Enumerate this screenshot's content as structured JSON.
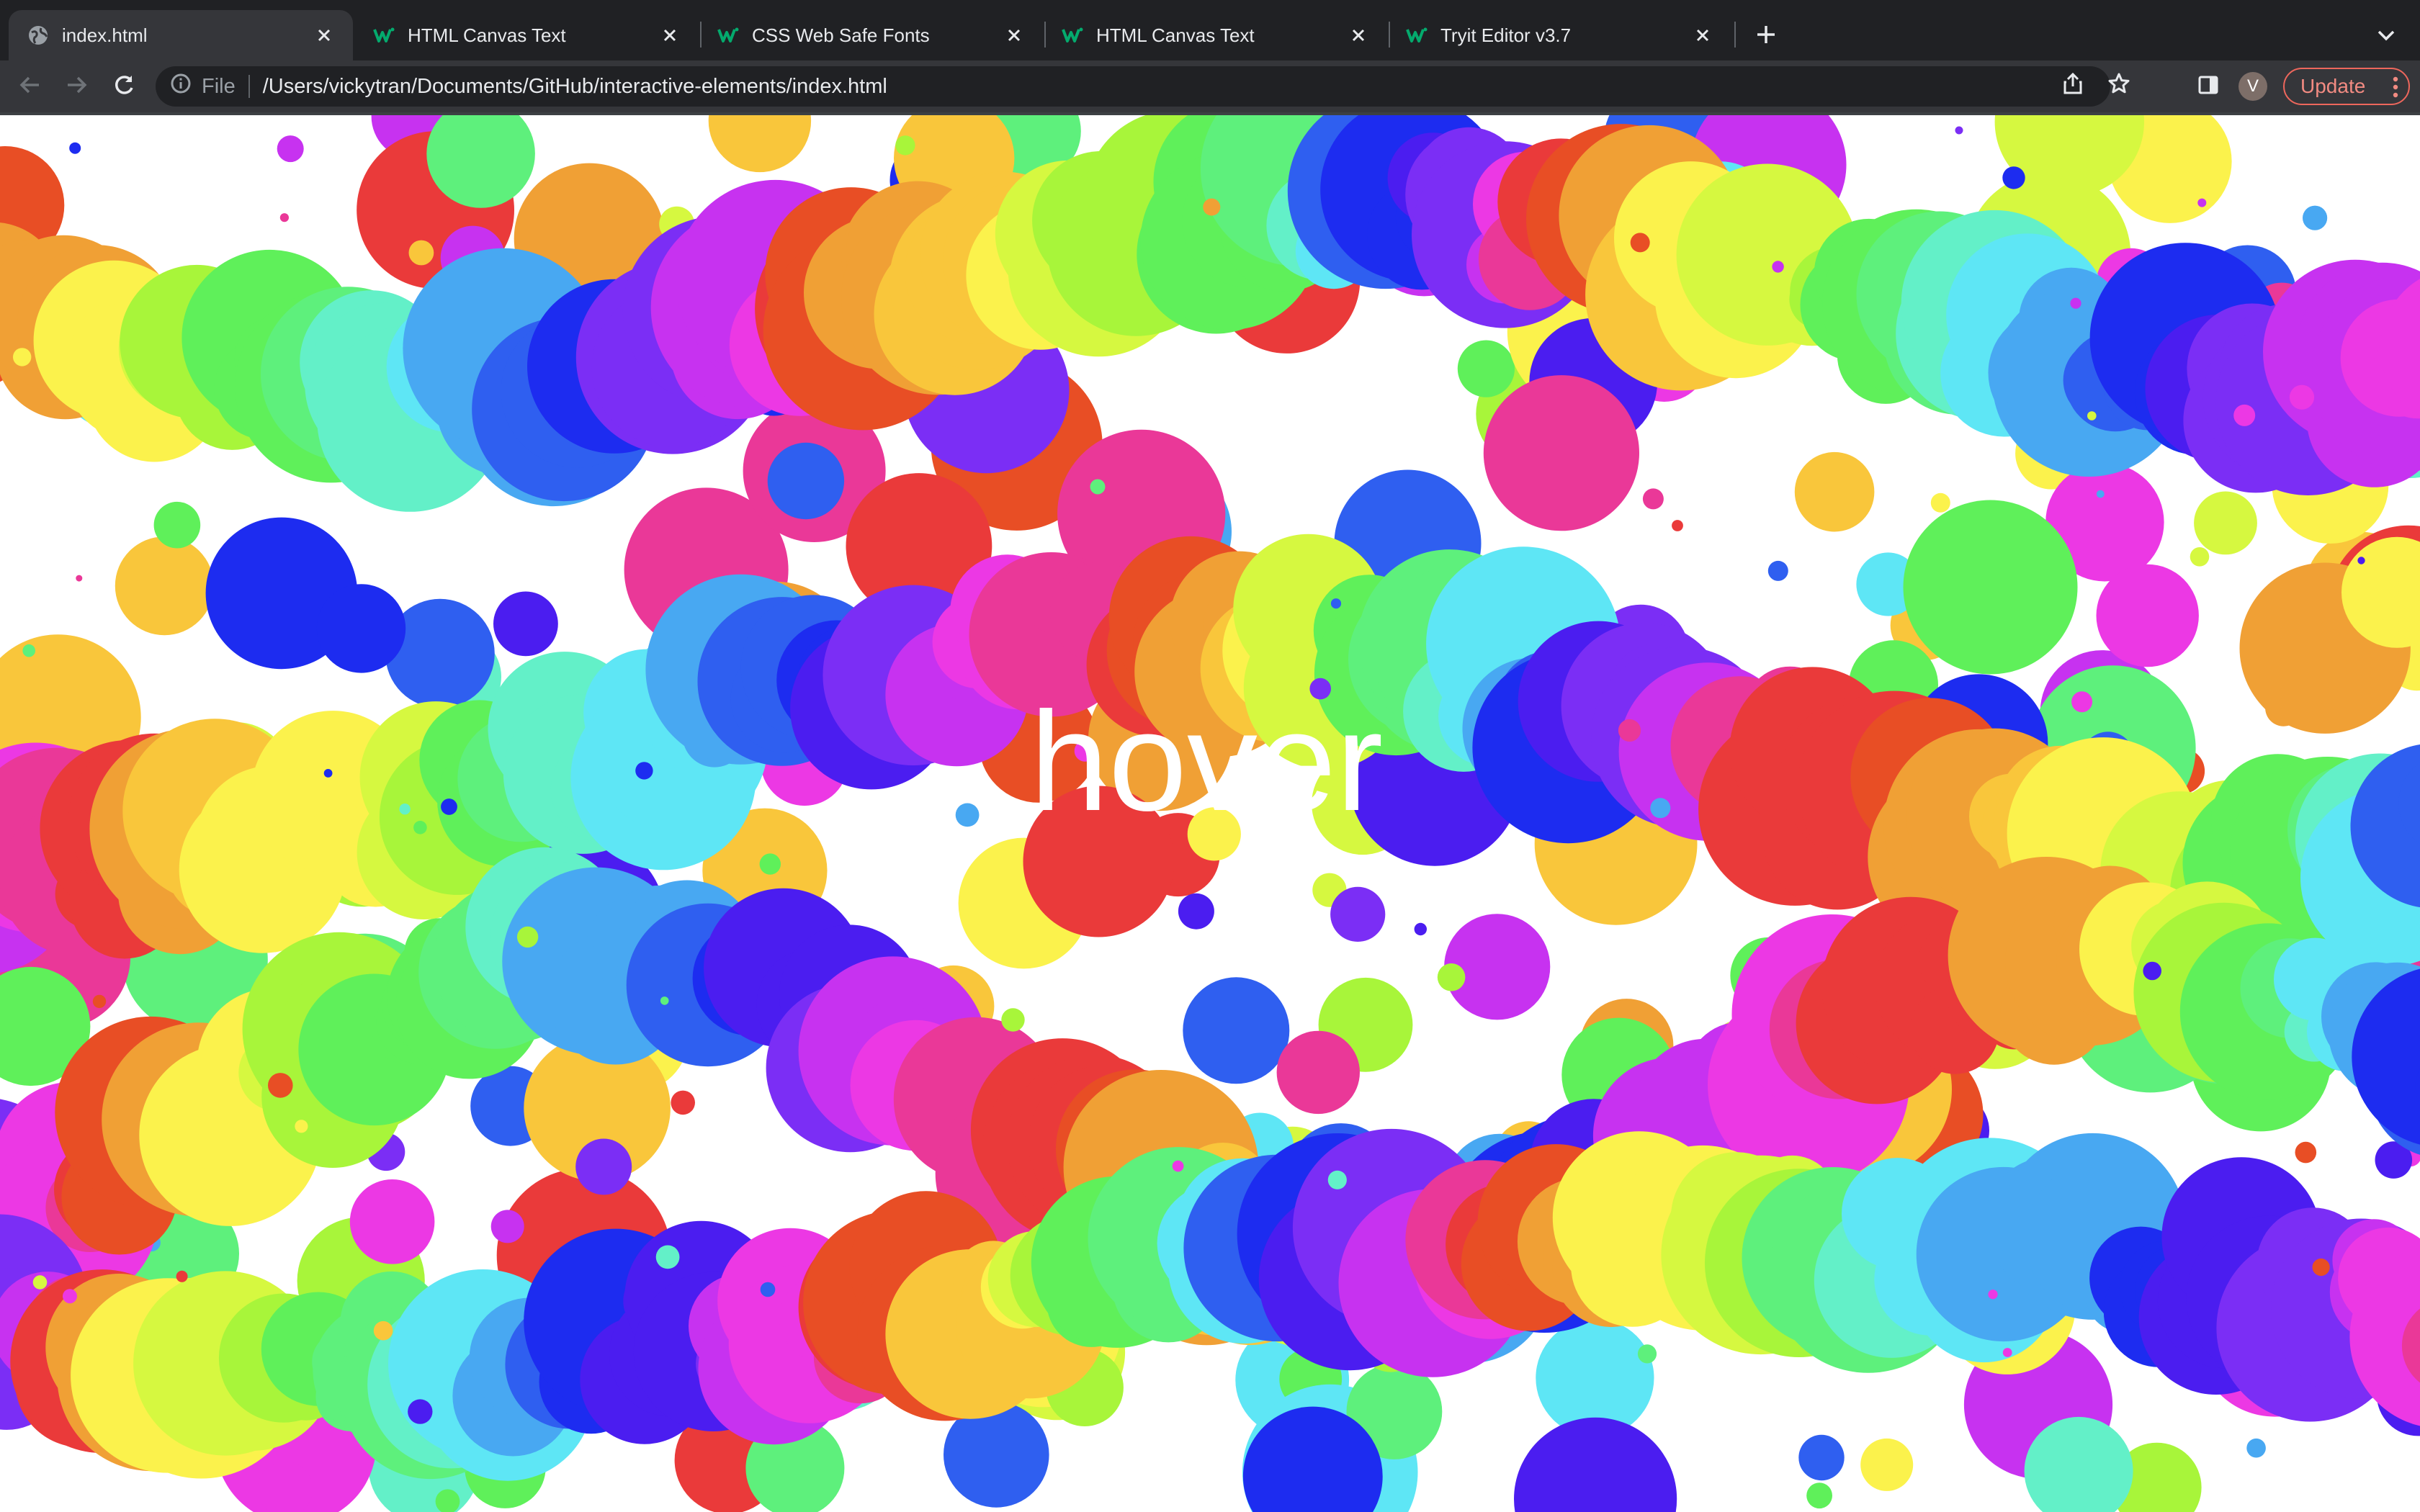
{
  "tabs": [
    {
      "title": "index.html",
      "icon": "globe-icon",
      "active": true
    },
    {
      "title": "HTML Canvas Text",
      "icon": "w3schools-icon",
      "active": false
    },
    {
      "title": "CSS Web Safe Fonts",
      "icon": "w3schools-icon",
      "active": false
    },
    {
      "title": "HTML Canvas Text",
      "icon": "w3schools-icon",
      "active": false
    },
    {
      "title": "Tryit Editor v3.7",
      "icon": "w3schools-icon",
      "active": false
    }
  ],
  "toolbar": {
    "site_info_label": "File",
    "url": "/Users/vickytran/Documents/GitHub/interactive-elements/index.html",
    "avatar_letter": "V",
    "update_label": "Update"
  },
  "page": {
    "canvas_text": "hover"
  },
  "colors": {
    "tab_strip_bg": "#202124",
    "toolbar_bg": "#35363a",
    "omnibox_bg": "#202124",
    "update_accent": "#f28b82",
    "w3schools_green": "#04aa6d",
    "page_bg": "#ffffff",
    "bubble_palette": [
      "#ea3a3a",
      "#e84e25",
      "#f0a035",
      "#f9c63b",
      "#fbf24c",
      "#d6f840",
      "#a8f53a",
      "#5ff05a",
      "#5ef07c",
      "#63f0c8",
      "#5ee6f5",
      "#48a8f2",
      "#2f5ff0",
      "#1d2cf0",
      "#4b1df0",
      "#7b2ef5",
      "#c732f0",
      "#ec38e4",
      "#ea3898"
    ]
  }
}
